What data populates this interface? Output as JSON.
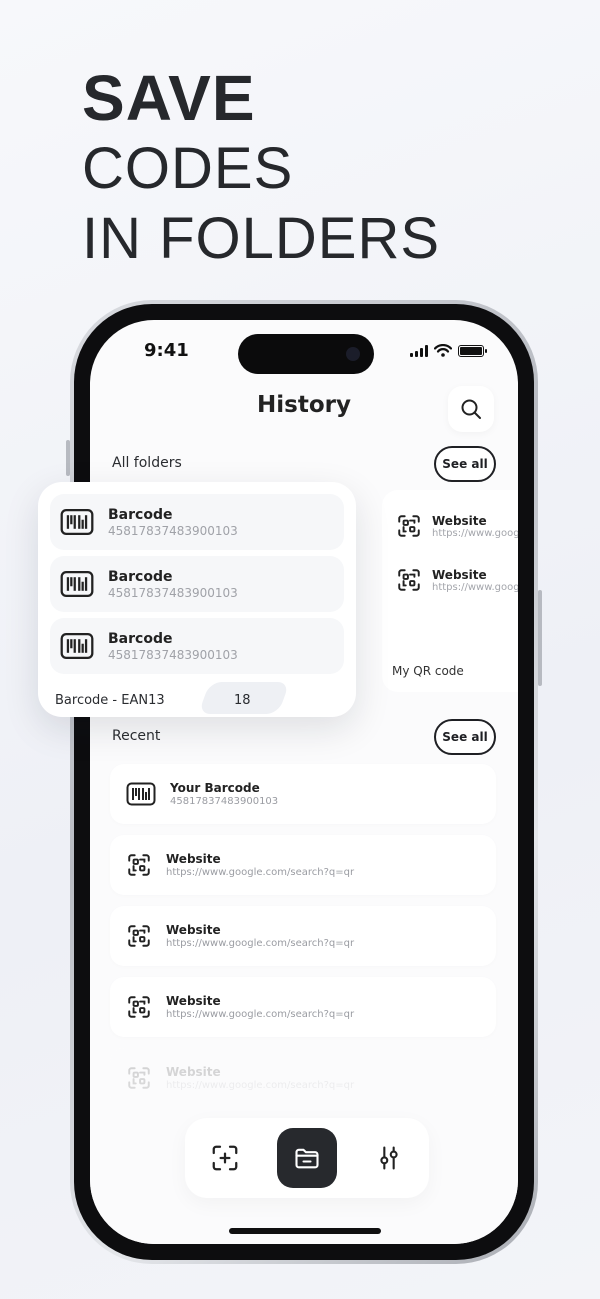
{
  "headline": {
    "line1": "SAVE",
    "line2": "CODES",
    "line3": "IN FOLDERS"
  },
  "status_bar": {
    "time": "9:41"
  },
  "header": {
    "title": "History"
  },
  "folders": {
    "label": "All folders",
    "see_all": "See all",
    "barcode_folder": {
      "items": [
        {
          "name": "Barcode",
          "code": "45817837483900103"
        },
        {
          "name": "Barcode",
          "code": "45817837483900103"
        },
        {
          "name": "Barcode",
          "code": "45817837483900103"
        }
      ],
      "folder_name": "Barcode - EAN13",
      "count": "18"
    },
    "qr_folder": {
      "items": [
        {
          "name": "Website",
          "url": "https://www.goog"
        },
        {
          "name": "Website",
          "url": "https://www.goog"
        }
      ],
      "folder_name": "My QR code"
    }
  },
  "recent": {
    "label": "Recent",
    "see_all": "See all",
    "items": [
      {
        "name": "Your Barcode",
        "sub": "45817837483900103",
        "icon": "barcode-icon"
      },
      {
        "name": "Website",
        "sub": "https://www.google.com/search?q=qr",
        "icon": "qr-code-icon"
      },
      {
        "name": "Website",
        "sub": "https://www.google.com/search?q=qr",
        "icon": "qr-code-icon"
      },
      {
        "name": "Website",
        "sub": "https://www.google.com/search?q=qr",
        "icon": "qr-code-icon"
      },
      {
        "name": "Website",
        "sub": "https://www.google.com/search?q=qr",
        "icon": "qr-code-icon"
      }
    ]
  },
  "tab_bar": {
    "tabs": [
      {
        "icon": "scan-add-icon",
        "active": false
      },
      {
        "icon": "folder-icon",
        "active": true
      },
      {
        "icon": "settings-sliders-icon",
        "active": false
      }
    ]
  },
  "colors": {
    "accent": "#27292d",
    "background": "#f3f4f8",
    "surface": "#ffffff",
    "muted_text": "#9a9ca2"
  }
}
